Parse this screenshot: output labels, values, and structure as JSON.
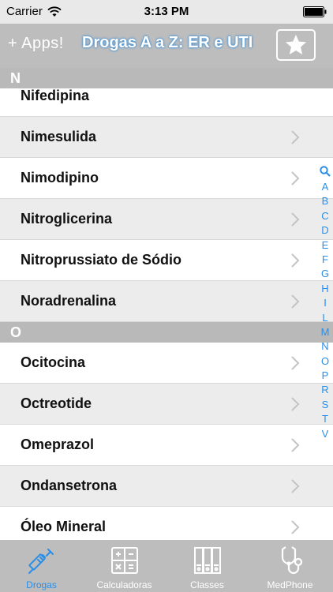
{
  "status_bar": {
    "carrier": "Carrier",
    "time": "3:13 PM"
  },
  "nav": {
    "apps_label": "+ Apps!",
    "title": "Drogas A a Z: ER e UTI"
  },
  "sections": [
    {
      "letter": "N",
      "items": [
        "Nifedipina",
        "Nimesulida",
        "Nimodipino",
        "Nitroglicerina",
        "Nitroprussiato de Sódio",
        "Noradrenalina"
      ]
    },
    {
      "letter": "O",
      "items": [
        "Ocitocina",
        "Octreotide",
        "Omeprazol",
        "Ondansetrona",
        "Óleo Mineral"
      ]
    }
  ],
  "index_letters": [
    "A",
    "B",
    "C",
    "D",
    "E",
    "F",
    "G",
    "H",
    "I",
    "L",
    "M",
    "N",
    "O",
    "P",
    "R",
    "S",
    "T",
    "V"
  ],
  "tabs": [
    {
      "label": "Drogas",
      "icon": "syringe-icon"
    },
    {
      "label": "Calculadoras",
      "icon": "calculator-icon"
    },
    {
      "label": "Classes",
      "icon": "binders-icon"
    },
    {
      "label": "MedPhone",
      "icon": "stethoscope-icon"
    }
  ],
  "colors": {
    "accent": "#2a8ee8",
    "bar": "#bdbdbd",
    "row_alt": "#ececec"
  }
}
